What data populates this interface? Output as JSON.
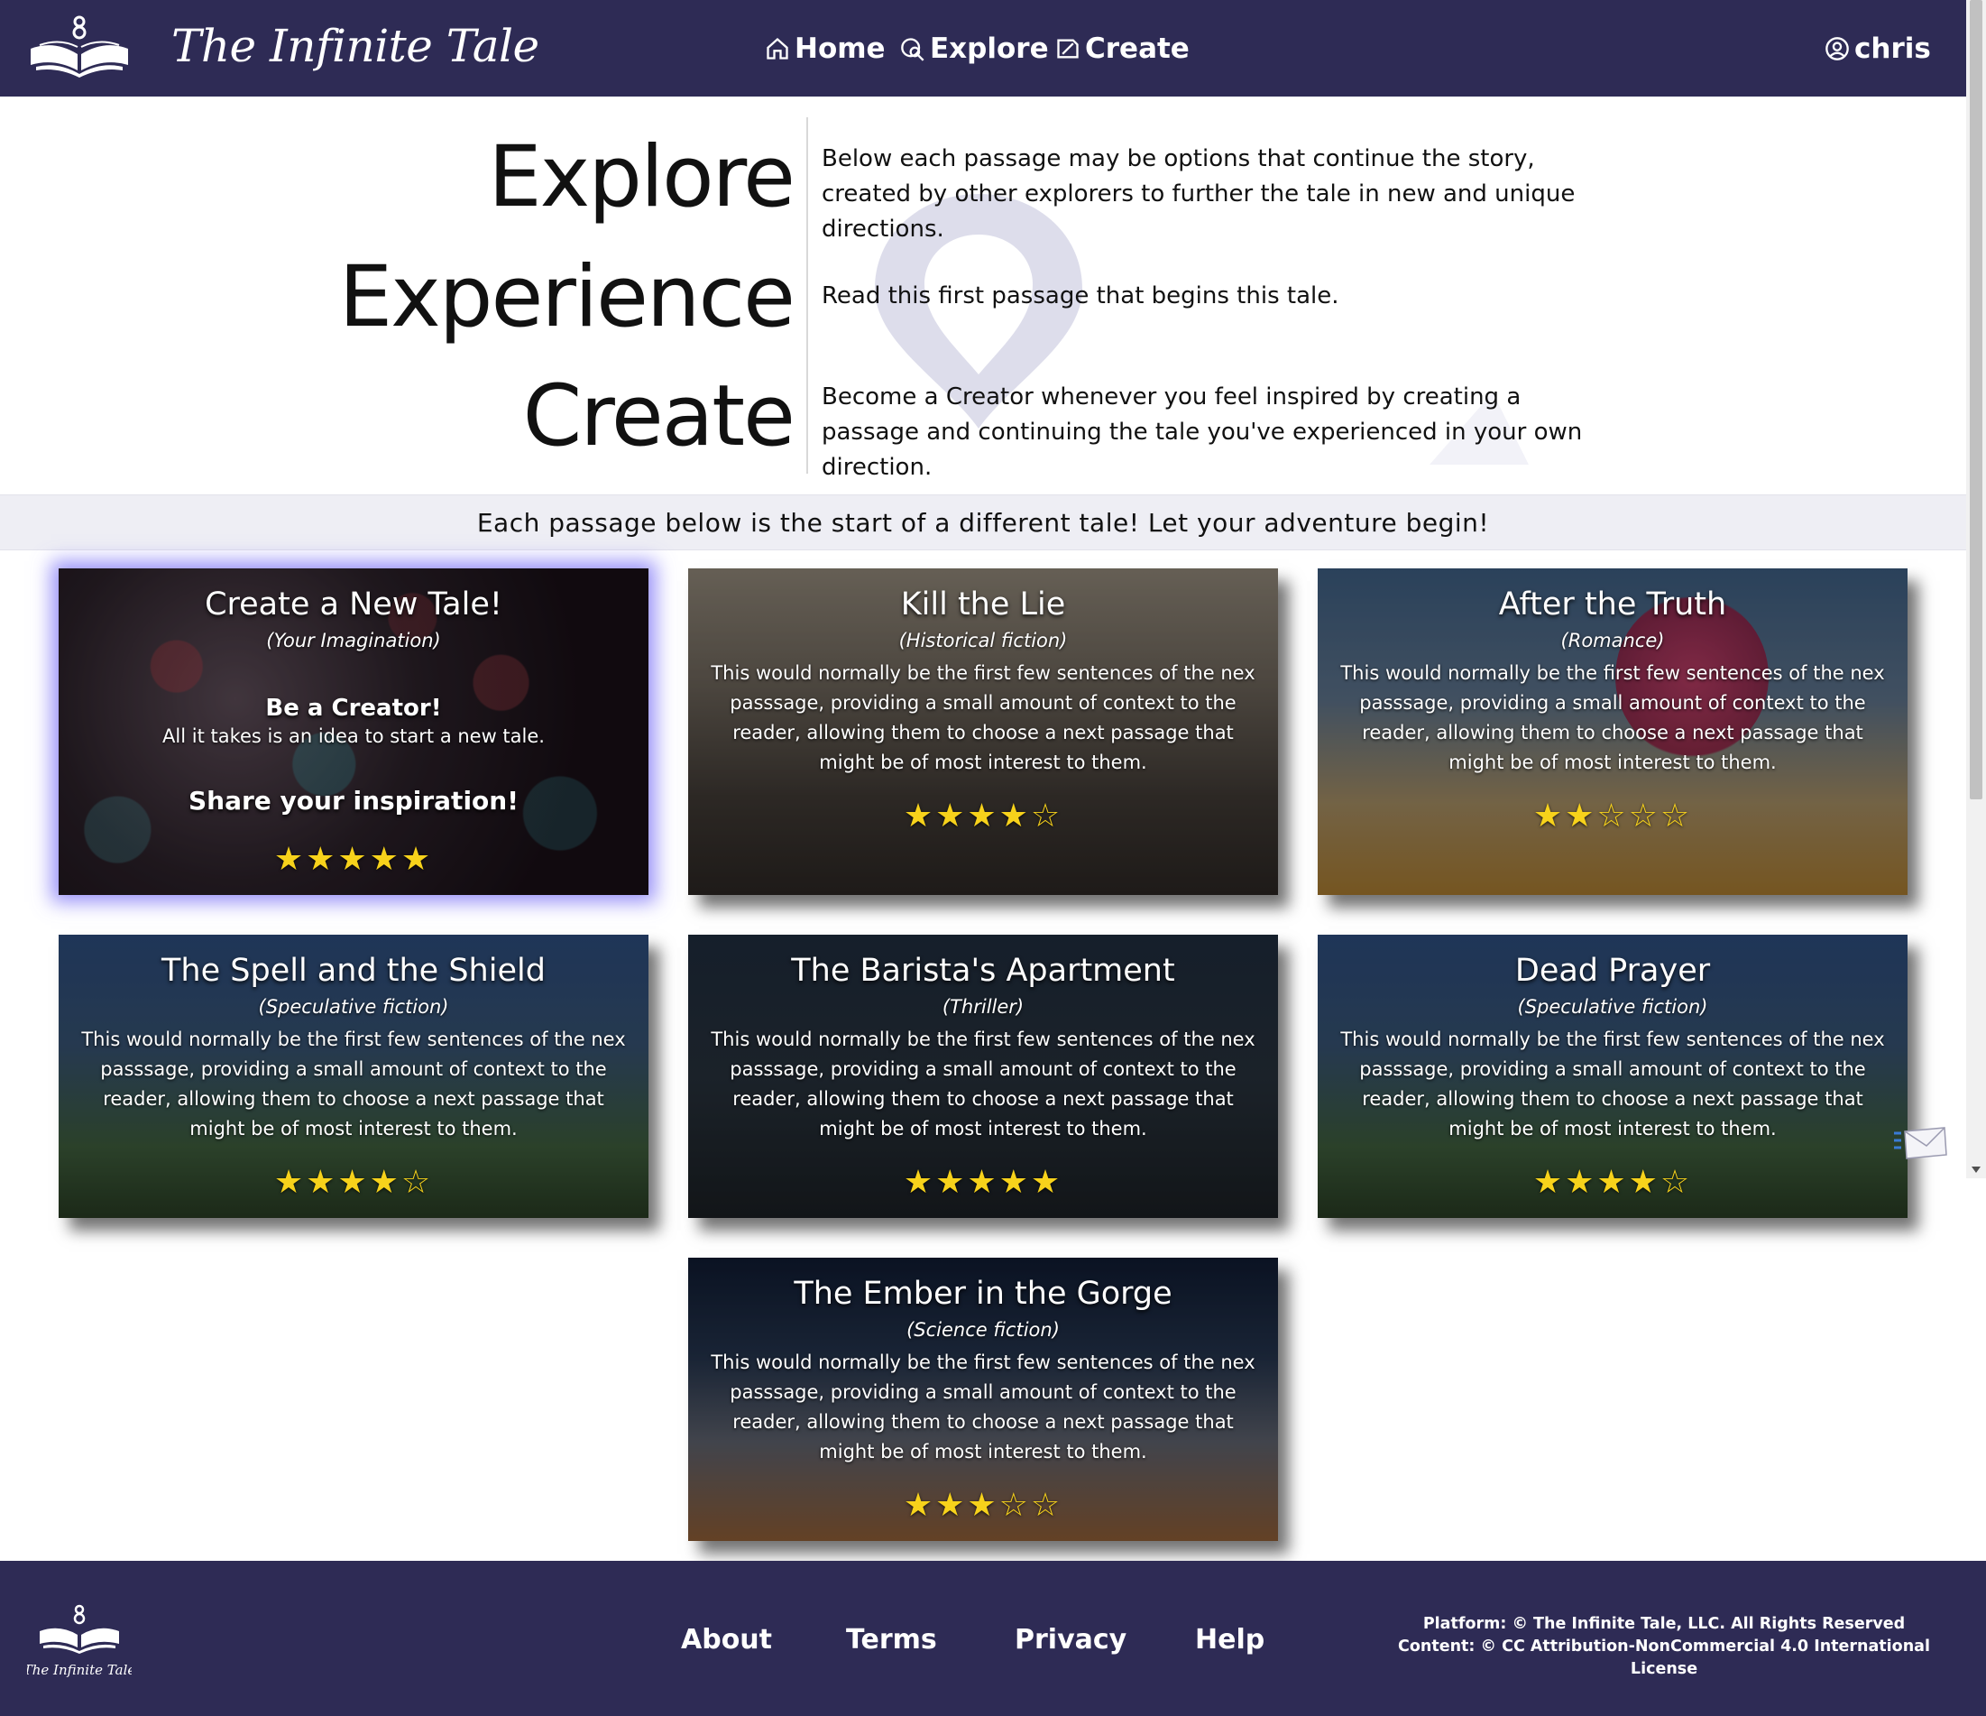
{
  "brand": {
    "name": "The Infinite Tale",
    "footer_name": "The Infinite Tale"
  },
  "nav": {
    "home": "Home",
    "explore": "Explore",
    "create": "Create",
    "user": "chris"
  },
  "hero": {
    "explore_word": "Explore",
    "experience_word": "Experience",
    "create_word": "Create",
    "explore_text": "Below each passage may be options that continue the story, created by other explorers to further the tale in new and unique directions.",
    "experience_text": "Read this first passage that begins this tale.",
    "create_text": "Become a Creator whenever you feel inspired by creating a passage and continuing the tale you've experienced in your own direction."
  },
  "banner": "Each passage below is the start of a different tale! Let your adventure begin!",
  "cards": [
    {
      "title": "Create a New Tale!",
      "genre": "(Your Imagination)",
      "heading": "Be a Creator!",
      "text": "All it takes is an idea to start a new tale.",
      "cta": "Share your inspiration!",
      "stars": "★★★★★",
      "rating": 5
    },
    {
      "title": "Kill the Lie",
      "genre": "(Historical fiction)",
      "desc": "This would normally be the first few sentences of the nex passsage, providing a small amount of context to the reader, allowing them to choose a next passage that might be of most interest to them.",
      "stars": "★★★★☆",
      "rating": 4
    },
    {
      "title": "After the Truth",
      "genre": "(Romance)",
      "desc": "This would normally be the first few sentences of the nex passsage, providing a small amount of context to the reader, allowing them to choose a next passage that might be of most interest to them.",
      "stars": "★★☆☆☆",
      "rating": 2
    },
    {
      "title": "The Spell and the Shield",
      "genre": "(Speculative fiction)",
      "desc": "This would normally be the first few sentences of the nex passsage, providing a small amount of context to the reader, allowing them to choose a next passage that might be of most interest to them.",
      "stars": "★★★★☆",
      "rating": 4
    },
    {
      "title": "The Barista's Apartment",
      "genre": "(Thriller)",
      "desc": "This would normally be the first few sentences of the nex passsage, providing a small amount of context to the reader, allowing them to choose a next passage that might be of most interest to them.",
      "stars": "★★★★★",
      "rating": 5
    },
    {
      "title": "Dead Prayer",
      "genre": "(Speculative fiction)",
      "desc": "This would normally be the first few sentences of the nex passsage, providing a small amount of context to the reader, allowing them to choose a next passage that might be of most interest to them.",
      "stars": "★★★★☆",
      "rating": 4
    },
    {
      "title": "The Ember in the Gorge",
      "genre": "(Science fiction)",
      "desc": "This would normally be the first few sentences of the nex passsage, providing a small amount of context to the reader, allowing them to choose a next passage that might be of most interest to them.",
      "stars": "★★★☆☆",
      "rating": 3
    }
  ],
  "footer": {
    "about": "About",
    "terms": "Terms",
    "privacy": "Privacy",
    "help": "Help",
    "platform_notice": "Platform: © The Infinite Tale, LLC. All Rights Reserved",
    "content_notice": "Content: © CC Attribution-NonCommercial 4.0 International License"
  },
  "icons": {
    "home": "home-icon",
    "explore": "explore-icon",
    "create": "create-icon",
    "user": "user-icon",
    "mail": "mail-icon"
  },
  "colors": {
    "nav_bg": "#2e2b55",
    "star": "#f7d21b",
    "highlight_glow": "#6e64f5",
    "banner_bg": "#eeeef4"
  }
}
